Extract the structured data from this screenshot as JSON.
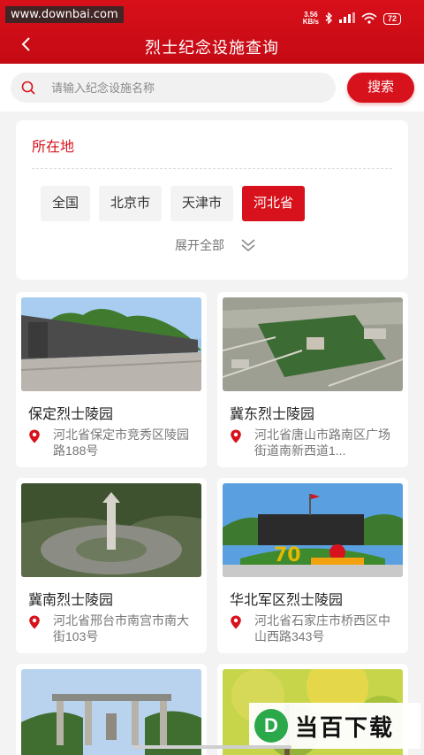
{
  "watermark": "www.downbai.com",
  "status": {
    "speed_top": "3.56",
    "speed_bottom": "KB/s",
    "battery": "72"
  },
  "header": {
    "title": "烈士纪念设施查询"
  },
  "search": {
    "placeholder": "请输入纪念设施名称",
    "button_label": "搜索"
  },
  "region": {
    "title": "所在地",
    "chips": [
      "全国",
      "北京市",
      "天津市",
      "河北省"
    ],
    "active_index": 3,
    "expand_label": "展开全部"
  },
  "cards": [
    {
      "name": "保定烈士陵园",
      "address": "河北省保定市竞秀区陵园路188号"
    },
    {
      "name": "冀东烈士陵园",
      "address": "河北省唐山市路南区广场街道南新西道1..."
    },
    {
      "name": "冀南烈士陵园",
      "address": "河北省邢台市南宫市南大街103号"
    },
    {
      "name": "华北军区烈士陵园",
      "address": "河北省石家庄市桥西区中山西路343号"
    },
    {
      "name": "",
      "address": ""
    },
    {
      "name": "",
      "address": ""
    }
  ],
  "logo": {
    "mark": "D",
    "text": "当百下载"
  },
  "colors": {
    "brand_red": "#d8121c",
    "page_bg": "#f3f3f3"
  }
}
